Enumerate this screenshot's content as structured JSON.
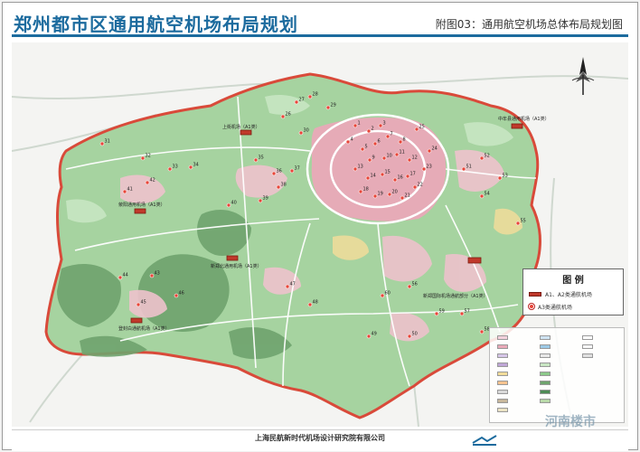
{
  "header": {
    "main_title": "郑州都市区通用航空机场布局规划",
    "sub_title": "附图03：通用航空机场总体布局规划图"
  },
  "legend": {
    "title": "图 例",
    "items": [
      {
        "label": "A1、A2类通航机场",
        "symbol": "red-rectangle"
      },
      {
        "label": "A3类通航机场",
        "symbol": "red-dot"
      }
    ]
  },
  "airports": [
    {
      "label": "上街机场（A1类）"
    },
    {
      "label": "中牟县通用机场（A1类）"
    },
    {
      "label": "荥阳通用机场（A1类）"
    },
    {
      "label": "新郑北通用机场（A1类）"
    },
    {
      "label": "登封白通航机场（A1类）"
    },
    {
      "label": "新郑国际机场通航部分（A1类）"
    }
  ],
  "site_markers": [
    "1",
    "2",
    "3",
    "4",
    "5",
    "6",
    "7",
    "8",
    "9",
    "10",
    "11",
    "12",
    "13",
    "14",
    "15",
    "16",
    "17",
    "18",
    "19",
    "20",
    "21",
    "22",
    "23",
    "24",
    "25",
    "26",
    "27",
    "28",
    "29",
    "30",
    "31",
    "32",
    "33",
    "34",
    "35",
    "36",
    "37",
    "38",
    "39",
    "40",
    "41",
    "42",
    "43",
    "44",
    "45",
    "46",
    "47",
    "48",
    "49",
    "50",
    "51",
    "52",
    "53",
    "54",
    "55",
    "56",
    "57",
    "58",
    "59",
    "60"
  ],
  "footer": {
    "organization": "上海民航新时代机场设计研究院有限公司",
    "watermark": "河南楼市"
  },
  "colors": {
    "title_blue": "#1c6b9e",
    "airport_red": "#c0392b",
    "urban_pink": "#e9a9b8",
    "green_space": "#8cc98a",
    "forest": "#6fa36e",
    "outline_red": "#d94a3a"
  }
}
